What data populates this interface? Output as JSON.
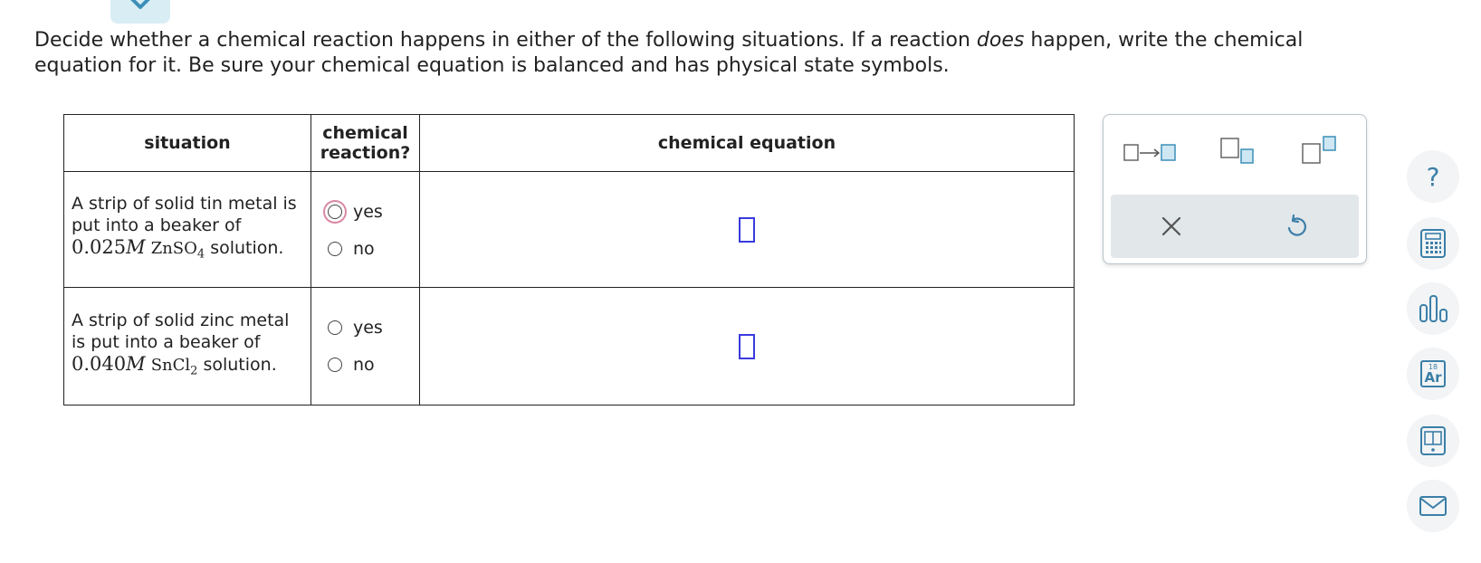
{
  "instructions": {
    "part1": "Decide whether a chemical reaction happens in either of the following situations. If a reaction ",
    "emph": "does",
    "part2": " happen, write the chemical equation for it. Be sure your chemical equation is balanced and has physical state symbols."
  },
  "table": {
    "headers": {
      "situation": "situation",
      "reaction_line1": "chemical",
      "reaction_line2": "reaction?",
      "equation": "chemical equation"
    },
    "rows": [
      {
        "situation_text": "A strip of solid tin metal is put into a beaker of",
        "concentration": "0.025",
        "molar_unit": "M",
        "formula_main": "ZnSO",
        "formula_sub": "4",
        "solution_word": " solution.",
        "option_yes": "yes",
        "option_no": "no"
      },
      {
        "situation_text": "A strip of solid zinc metal is put into a beaker of",
        "concentration": "0.040",
        "molar_unit": "M",
        "formula_main": "SnCl",
        "formula_sub": "2",
        "solution_word": " solution.",
        "option_yes": "yes",
        "option_no": "no"
      }
    ]
  },
  "palette": {
    "buttons": [
      "reaction-arrow-icon",
      "subscript-icon",
      "superscript-icon"
    ],
    "actions": [
      "close-icon",
      "undo-icon"
    ]
  },
  "sidebar": {
    "items": [
      "help-icon",
      "calculator-icon",
      "bar-chart-icon",
      "periodic-table-icon",
      "textbook-icon",
      "mail-icon"
    ],
    "periodic_number": "18",
    "periodic_symbol": "Ar",
    "help_glyph": "?"
  },
  "colors": {
    "accent": "#3b7fa8",
    "answer_box": "#3a3adf",
    "focus_ring": "#d987a4",
    "tab_bg": "#d9eef4"
  }
}
